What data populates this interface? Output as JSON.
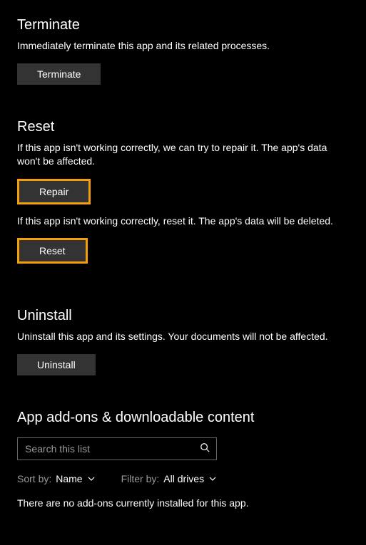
{
  "terminate": {
    "title": "Terminate",
    "description": "Immediately terminate this app and its related processes.",
    "button": "Terminate"
  },
  "reset": {
    "title": "Reset",
    "repair_description": "If this app isn't working correctly, we can try to repair it. The app's data won't be affected.",
    "repair_button": "Repair",
    "reset_description": "If this app isn't working correctly, reset it. The app's data will be deleted.",
    "reset_button": "Reset"
  },
  "uninstall": {
    "title": "Uninstall",
    "description": "Uninstall this app and its settings. Your documents will not be affected.",
    "button": "Uninstall"
  },
  "addons": {
    "title": "App add-ons & downloadable content",
    "search_placeholder": "Search this list",
    "sort_label": "Sort by:",
    "sort_value": "Name",
    "filter_label": "Filter by:",
    "filter_value": "All drives",
    "empty": "There are no add-ons currently installed for this app."
  },
  "colors": {
    "highlight": "#f59e0b"
  }
}
